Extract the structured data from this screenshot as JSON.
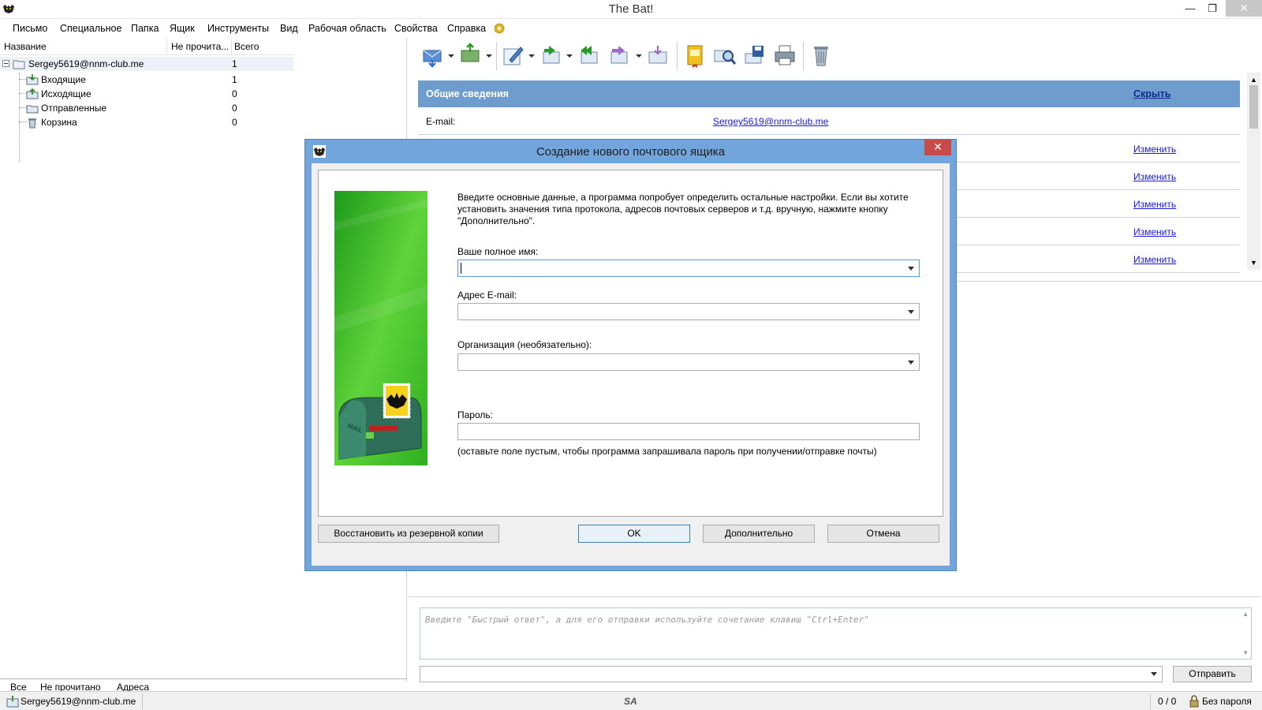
{
  "window": {
    "title": "The Bat!"
  },
  "menu": [
    "Письмо",
    "Специальное",
    "Папка",
    "Ящик",
    "Инструменты",
    "Вид",
    "Рабочая область",
    "Свойства",
    "Справка"
  ],
  "folder_panel": {
    "columns": {
      "name": "Название",
      "unread": "Не прочита...",
      "total": "Всего"
    },
    "account": {
      "name": "Sergey5619@nnm-club.me",
      "count": "1"
    },
    "folders": [
      {
        "name": "Входящие",
        "count": "1"
      },
      {
        "name": "Исходящие",
        "count": "0"
      },
      {
        "name": "Отправленные",
        "count": "0"
      },
      {
        "name": "Корзина",
        "count": "0"
      }
    ],
    "tabs": [
      "Все",
      "Не прочитано",
      "Адреса"
    ]
  },
  "info_panel": {
    "title": "Общие сведения",
    "hide_label": "Скрыть",
    "email_label": "E-mail:",
    "email_value": "Sergey5619@nnm-club.me",
    "edit_label": "Изменить"
  },
  "quick_reply": {
    "placeholder": "Введите \"Быстрый ответ\", а для его отправки используйте сочетание клавиш \"Ctrl+Enter\"",
    "send_label": "Отправить"
  },
  "status_bar": {
    "account": "Sergey5619@nnm-club.me",
    "center": "SA",
    "counter": "0 / 0",
    "security": "Без пароля"
  },
  "dialog": {
    "title": "Создание нового почтового ящика",
    "intro_lines": [
      "Введите основные данные, а программа попробует определить остальные настройки. Если вы хотите",
      "установить значения типа протокола, адресов почтовых серверов и т.д. вручную, нажмите кнопку",
      "\"Дополнительно\"."
    ],
    "full_name_label": "Ваше полное имя:",
    "full_name_value": "",
    "email_label": "Адрес E-mail:",
    "email_value": "",
    "org_label": "Организация (необязательно):",
    "org_value": "",
    "password_label": "Пароль:",
    "password_value": "",
    "password_hint": "(оставьте поле пустым, чтобы программа запрашивала пароль при получении/отправке почты)",
    "buttons": {
      "restore": "Восстановить из резервной копии",
      "ok": "OK",
      "advanced": "Дополнительно",
      "cancel": "Отмена"
    }
  },
  "colors": {
    "header_blue": "#6d9ccd",
    "dialog_border": "#71a5db",
    "close_red": "#c74b4b",
    "banner_green": "#3fbf2a"
  }
}
